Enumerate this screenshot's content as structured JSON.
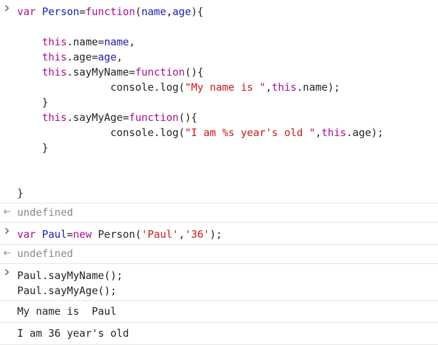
{
  "console": {
    "entries": [
      {
        "type": "input",
        "lines": [
          [
            [
              "kw",
              "var"
            ],
            [
              "plain",
              " "
            ],
            [
              "fn",
              "Person"
            ],
            [
              "plain",
              "="
            ],
            [
              "kw",
              "function"
            ],
            [
              "plain",
              "("
            ],
            [
              "fn",
              "name"
            ],
            [
              "plain",
              ","
            ],
            [
              "fn",
              "age"
            ],
            [
              "plain",
              "){"
            ]
          ],
          [],
          [
            [
              "plain",
              "    "
            ],
            [
              "kw",
              "this"
            ],
            [
              "plain",
              ".name="
            ],
            [
              "fn",
              "name"
            ],
            [
              "plain",
              ","
            ]
          ],
          [
            [
              "plain",
              "    "
            ],
            [
              "kw",
              "this"
            ],
            [
              "plain",
              ".age="
            ],
            [
              "fn",
              "age"
            ],
            [
              "plain",
              ","
            ]
          ],
          [
            [
              "plain",
              "    "
            ],
            [
              "kw",
              "this"
            ],
            [
              "plain",
              ".sayMyName="
            ],
            [
              "kw",
              "function"
            ],
            [
              "plain",
              "(){"
            ]
          ],
          [
            [
              "plain",
              "               console.log("
            ],
            [
              "str",
              "\"My name is \""
            ],
            [
              "plain",
              ","
            ],
            [
              "kw",
              "this"
            ],
            [
              "plain",
              ".name);"
            ]
          ],
          [
            [
              "plain",
              "    }"
            ]
          ],
          [
            [
              "plain",
              "    "
            ],
            [
              "kw",
              "this"
            ],
            [
              "plain",
              ".sayMyAge="
            ],
            [
              "kw",
              "function"
            ],
            [
              "plain",
              "(){"
            ]
          ],
          [
            [
              "plain",
              "               console.log("
            ],
            [
              "str",
              "\"I am %s year's old \""
            ],
            [
              "plain",
              ","
            ],
            [
              "kw",
              "this"
            ],
            [
              "plain",
              ".age);"
            ]
          ],
          [
            [
              "plain",
              "    }"
            ]
          ],
          [],
          [],
          [
            [
              "plain",
              "}"
            ]
          ]
        ]
      },
      {
        "type": "result",
        "text": "undefined"
      },
      {
        "type": "input",
        "lines": [
          [
            [
              "kw",
              "var"
            ],
            [
              "plain",
              " "
            ],
            [
              "fn",
              "Paul"
            ],
            [
              "plain",
              "="
            ],
            [
              "kw",
              "new"
            ],
            [
              "plain",
              " Person("
            ],
            [
              "str",
              "'Paul'"
            ],
            [
              "plain",
              ","
            ],
            [
              "str",
              "'36'"
            ],
            [
              "plain",
              ");"
            ]
          ]
        ]
      },
      {
        "type": "result",
        "text": "undefined"
      },
      {
        "type": "input",
        "lines": [
          [
            [
              "plain",
              "Paul.sayMyName();"
            ]
          ],
          [
            [
              "plain",
              "Paul.sayMyAge();"
            ]
          ]
        ]
      },
      {
        "type": "log",
        "text": "My name is  Paul"
      },
      {
        "type": "log",
        "text": "I am 36 year's old"
      }
    ]
  },
  "icons": {
    "input_prompt": "chevron-right-icon",
    "result": "return-arrow-icon"
  },
  "colors": {
    "keyword": "#aa0d91",
    "identifier": "#1a1aa6",
    "string": "#c41a16",
    "text": "#222222",
    "muted": "#8a8a8a",
    "divider": "#e6e6e6"
  }
}
